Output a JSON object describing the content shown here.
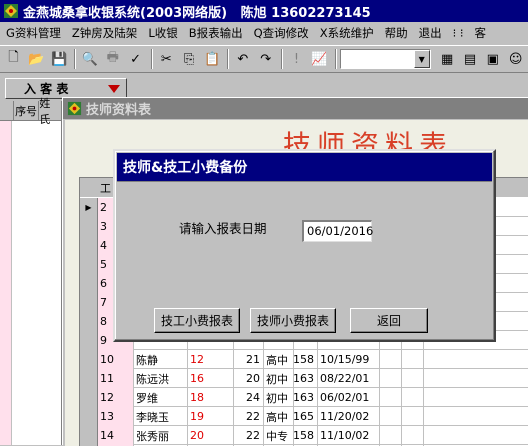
{
  "app": {
    "title": "金燕城桑拿收银系统(2003网络版)   陈旭 13602273145",
    "icon": "hotel-app-icon"
  },
  "menu": [
    "G资料管理",
    "Z钟房及陆架",
    "L收银",
    "B报表输出",
    "Q查询修改",
    "X系统维护",
    "帮助",
    "退出",
    "⁝ ⁝",
    "客"
  ],
  "toolbar": {
    "icons": [
      "new-doc-icon",
      "open-folder-icon",
      "save-icon",
      "print-preview-icon",
      "print-icon",
      "spell-check-icon",
      "cut-icon",
      "copy-icon",
      "paste-icon",
      "undo-icon",
      "redo-icon",
      "warning-icon",
      "chart-icon",
      "calendar-icon",
      "notes-icon",
      "card-icon",
      "person-icon"
    ],
    "combo_value": ""
  },
  "left_panel": {
    "tab_label": "入 客 表",
    "columns": [
      "序号",
      "姓氏"
    ]
  },
  "child_window": {
    "title": "技师资料表",
    "report_title": "技师资料表"
  },
  "grid": {
    "header_label": "工",
    "rows": [
      {
        "no": "2",
        "name": "",
        "num": "",
        "age": "",
        "edu": "",
        "h": "",
        "date": "",
        "current": true
      },
      {
        "no": "3",
        "name": "",
        "num": "",
        "age": "",
        "edu": "",
        "h": "",
        "date": ""
      },
      {
        "no": "4",
        "name": "",
        "num": "",
        "age": "",
        "edu": "",
        "h": "",
        "date": ""
      },
      {
        "no": "5",
        "name": "",
        "num": "",
        "age": "",
        "edu": "",
        "h": "",
        "date": ""
      },
      {
        "no": "6",
        "name": "",
        "num": "",
        "age": "",
        "edu": "",
        "h": "",
        "date": ""
      },
      {
        "no": "7",
        "name": "",
        "num": "",
        "age": "",
        "edu": "",
        "h": "",
        "date": ""
      },
      {
        "no": "8",
        "name": "",
        "num": "",
        "age": "",
        "edu": "",
        "h": "",
        "date": ""
      },
      {
        "no": "9",
        "name": "",
        "num": "",
        "age": "",
        "edu": "",
        "h": "",
        "date": ""
      },
      {
        "no": "10",
        "name": "陈静",
        "num": "12",
        "age": "21",
        "edu": "高中",
        "h": "158",
        "date": "10/15/99"
      },
      {
        "no": "11",
        "name": "陈远洪",
        "num": "16",
        "age": "20",
        "edu": "初中",
        "h": "163",
        "date": "08/22/01"
      },
      {
        "no": "12",
        "name": "罗维",
        "num": "18",
        "age": "24",
        "edu": "初中",
        "h": "163",
        "date": "06/02/01"
      },
      {
        "no": "13",
        "name": "李晓玉",
        "num": "19",
        "age": "22",
        "edu": "高中",
        "h": "165",
        "date": "11/20/02"
      },
      {
        "no": "14",
        "name": "张秀丽",
        "num": "20",
        "age": "22",
        "edu": "中专",
        "h": "158",
        "date": "11/10/02"
      },
      {
        "no": "15",
        "name": "张瑜",
        "num": "21",
        "age": "21",
        "edu": "初中",
        "h": "160",
        "date": "12/06/01"
      }
    ]
  },
  "dialog": {
    "title": "技师&技工小费备份",
    "prompt": "请输入报表日期",
    "date_value": "06/01/2016",
    "buttons": [
      "技工小费报表",
      "技师小费报表",
      "返回"
    ]
  },
  "colors": {
    "active_title": "#00007f",
    "inactive_title": "#808080",
    "report_title": "#d84028",
    "number_red": "#e00000",
    "row_pink": "#ffe0ec"
  }
}
